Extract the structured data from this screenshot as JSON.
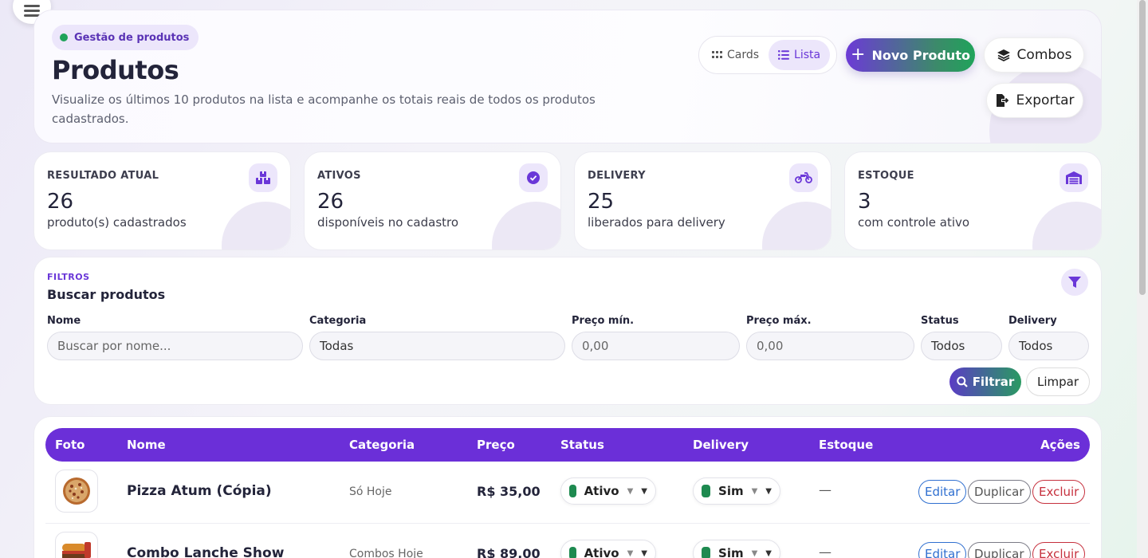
{
  "hero": {
    "badge": "Gestão de produtos",
    "title": "Produtos",
    "description": "Visualize os últimos 10 produtos na lista e acompanhe os totais reais de todos os produtos cadastrados.",
    "view_cards": "Cards",
    "view_list": "Lista",
    "active_view": "Lista",
    "new_product": "Novo Produto",
    "combos": "Combos",
    "export": "Exportar"
  },
  "stats": [
    {
      "label": "RESULTADO ATUAL",
      "value": "26",
      "desc": "produto(s) cadastrados",
      "icon": "boxes-icon"
    },
    {
      "label": "ATIVOS",
      "value": "26",
      "desc": "disponíveis no cadastro",
      "icon": "check-circle-icon"
    },
    {
      "label": "DELIVERY",
      "value": "25",
      "desc": "liberados para delivery",
      "icon": "motorcycle-icon"
    },
    {
      "label": "ESTOQUE",
      "value": "3",
      "desc": "com controle ativo",
      "icon": "warehouse-icon"
    }
  ],
  "filters": {
    "kicker": "FILTROS",
    "title": "Buscar produtos",
    "nome_label": "Nome",
    "nome_placeholder": "Buscar por nome...",
    "categoria_label": "Categoria",
    "categoria_value": "Todas",
    "preco_min_label": "Preço mín.",
    "preco_min_placeholder": "0,00",
    "preco_max_label": "Preço máx.",
    "preco_max_placeholder": "0,00",
    "status_label": "Status",
    "status_value": "Todos",
    "delivery_label": "Delivery",
    "delivery_value": "Todos",
    "filter_button": "Filtrar",
    "clear_button": "Limpar"
  },
  "table": {
    "headers": {
      "foto": "Foto",
      "nome": "Nome",
      "categoria": "Categoria",
      "preco": "Preço",
      "status": "Status",
      "delivery": "Delivery",
      "estoque": "Estoque",
      "acoes": "Ações"
    },
    "rows": [
      {
        "nome": "Pizza Atum (Cópia)",
        "categoria": "Só Hoje",
        "preco": "R$ 35,00",
        "status": "Ativo",
        "delivery": "Sim",
        "estoque": "—",
        "edit": "Editar",
        "duplicate": "Duplicar",
        "delete": "Excluir"
      },
      {
        "nome": "Combo Lanche Show",
        "categoria": "Combos Hoje",
        "preco": "R$ 89,00",
        "status": "Ativo",
        "delivery": "Sim",
        "estoque": "—",
        "edit": "Editar",
        "duplicate": "Duplicar",
        "delete": "Excluir"
      }
    ]
  },
  "colors": {
    "accent": "#6b2fd8",
    "success": "#1e8a50",
    "danger": "#c6303d",
    "link": "#2f6fd0"
  }
}
